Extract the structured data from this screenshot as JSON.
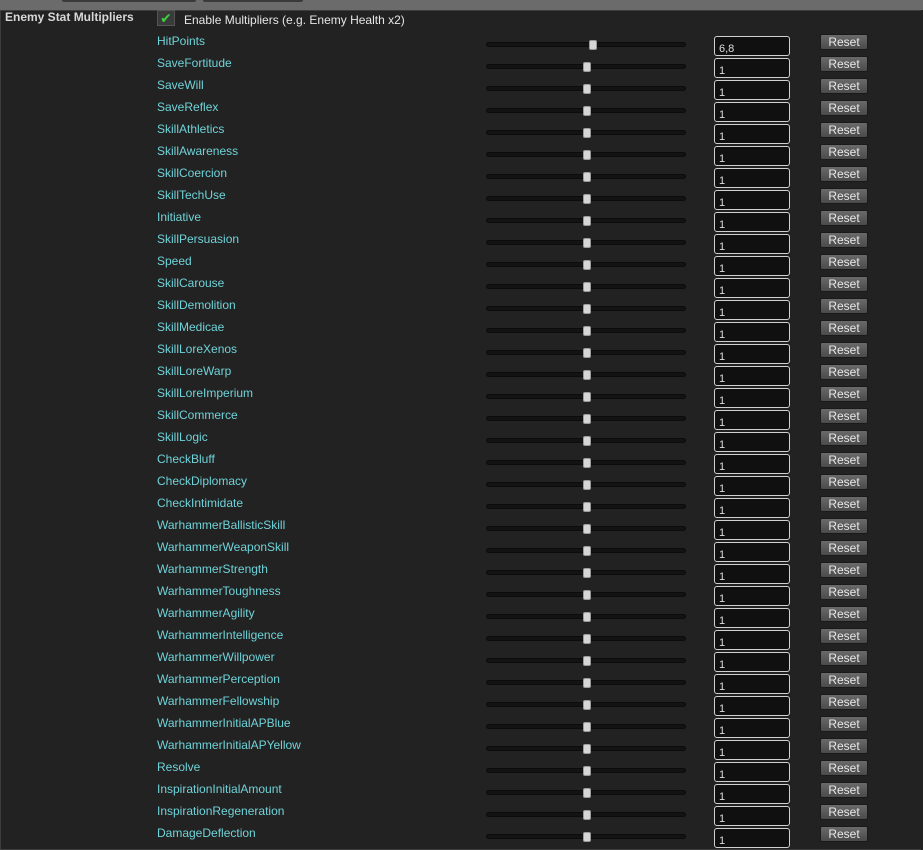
{
  "section": {
    "title": "Enemy Stat Multipliers",
    "enable_label": "Enable Multipliers (e.g. Enemy Health x2)",
    "enable_checked": true,
    "check_glyph": "✔"
  },
  "reset_label": "Reset",
  "rows": [
    {
      "label": "HitPoints",
      "value": "6,8",
      "slider": 0.53
    },
    {
      "label": "SaveFortitude",
      "value": "1",
      "slider": 0.5
    },
    {
      "label": "SaveWill",
      "value": "1",
      "slider": 0.5
    },
    {
      "label": "SaveReflex",
      "value": "1",
      "slider": 0.5
    },
    {
      "label": "SkillAthletics",
      "value": "1",
      "slider": 0.5
    },
    {
      "label": "SkillAwareness",
      "value": "1",
      "slider": 0.5
    },
    {
      "label": "SkillCoercion",
      "value": "1",
      "slider": 0.5
    },
    {
      "label": "SkillTechUse",
      "value": "1",
      "slider": 0.5
    },
    {
      "label": "Initiative",
      "value": "1",
      "slider": 0.5
    },
    {
      "label": "SkillPersuasion",
      "value": "1",
      "slider": 0.5
    },
    {
      "label": "Speed",
      "value": "1",
      "slider": 0.5
    },
    {
      "label": "SkillCarouse",
      "value": "1",
      "slider": 0.5
    },
    {
      "label": "SkillDemolition",
      "value": "1",
      "slider": 0.5
    },
    {
      "label": "SkillMedicae",
      "value": "1",
      "slider": 0.5
    },
    {
      "label": "SkillLoreXenos",
      "value": "1",
      "slider": 0.5
    },
    {
      "label": "SkillLoreWarp",
      "value": "1",
      "slider": 0.5
    },
    {
      "label": "SkillLoreImperium",
      "value": "1",
      "slider": 0.5
    },
    {
      "label": "SkillCommerce",
      "value": "1",
      "slider": 0.5
    },
    {
      "label": "SkillLogic",
      "value": "1",
      "slider": 0.5
    },
    {
      "label": "CheckBluff",
      "value": "1",
      "slider": 0.5
    },
    {
      "label": "CheckDiplomacy",
      "value": "1",
      "slider": 0.5
    },
    {
      "label": "CheckIntimidate",
      "value": "1",
      "slider": 0.5
    },
    {
      "label": "WarhammerBallisticSkill",
      "value": "1",
      "slider": 0.5
    },
    {
      "label": "WarhammerWeaponSkill",
      "value": "1",
      "slider": 0.5
    },
    {
      "label": "WarhammerStrength",
      "value": "1",
      "slider": 0.5
    },
    {
      "label": "WarhammerToughness",
      "value": "1",
      "slider": 0.5
    },
    {
      "label": "WarhammerAgility",
      "value": "1",
      "slider": 0.5
    },
    {
      "label": "WarhammerIntelligence",
      "value": "1",
      "slider": 0.5
    },
    {
      "label": "WarhammerWillpower",
      "value": "1",
      "slider": 0.5
    },
    {
      "label": "WarhammerPerception",
      "value": "1",
      "slider": 0.5
    },
    {
      "label": "WarhammerFellowship",
      "value": "1",
      "slider": 0.5
    },
    {
      "label": "WarhammerInitialAPBlue",
      "value": "1",
      "slider": 0.5
    },
    {
      "label": "WarhammerInitialAPYellow",
      "value": "1",
      "slider": 0.5
    },
    {
      "label": "Resolve",
      "value": "1",
      "slider": 0.5
    },
    {
      "label": "InspirationInitialAmount",
      "value": "1",
      "slider": 0.5
    },
    {
      "label": "InspirationRegeneration",
      "value": "1",
      "slider": 0.5
    },
    {
      "label": "DamageDeflection",
      "value": "1",
      "slider": 0.5
    }
  ]
}
